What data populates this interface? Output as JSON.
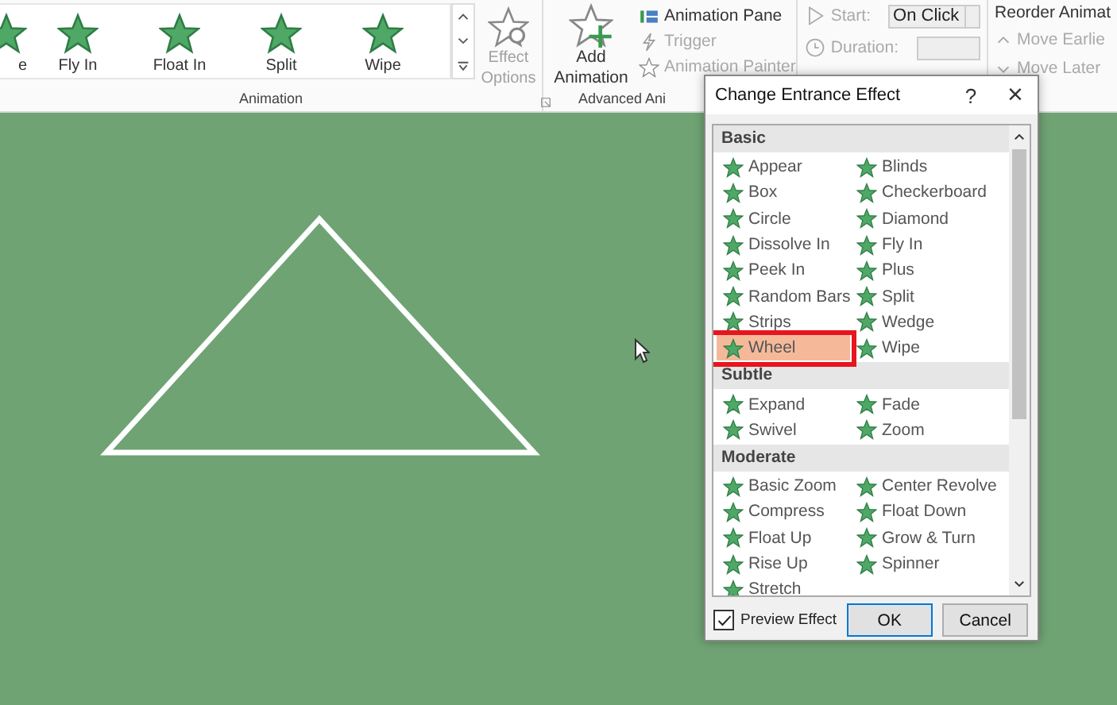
{
  "ribbon": {
    "gallery": [
      {
        "label": "e",
        "disabled": false
      },
      {
        "label": "Fly In",
        "disabled": false
      },
      {
        "label": "Float In",
        "disabled": false
      },
      {
        "label": "Split",
        "disabled": false
      },
      {
        "label": "Wipe",
        "disabled": false
      }
    ],
    "effect_options": {
      "label": "Effect Options",
      "disabled": true
    },
    "animation_group": "Animation",
    "add_animation": "Add Animation",
    "advanced": [
      {
        "label": "Animation Pane",
        "disabled": false
      },
      {
        "label": "Trigger",
        "disabled": true
      },
      {
        "label": "Animation Painter",
        "disabled": true
      }
    ],
    "advanced_group": "Advanced Ani",
    "timing": [
      {
        "label": "Start:",
        "value": "On Click",
        "kind": "dropdown"
      },
      {
        "label": "Duration:",
        "kind": "spin"
      }
    ],
    "reorder_title": "Reorder Animat",
    "reorder": [
      {
        "label": "Move Earlie",
        "disabled": true
      },
      {
        "label": "Move Later",
        "disabled": true
      }
    ]
  },
  "dialog": {
    "title": "Change Entrance Effect",
    "help": "?",
    "close": "×",
    "groups": [
      {
        "name": "Basic",
        "effects": [
          {
            "label": "Appear",
            "selected": false
          },
          {
            "label": "Blinds",
            "selected": false
          },
          {
            "label": "Box",
            "selected": false
          },
          {
            "label": "Checkerboard",
            "selected": false
          },
          {
            "label": "Circle",
            "selected": false
          },
          {
            "label": "Diamond",
            "selected": false
          },
          {
            "label": "Dissolve In",
            "selected": false
          },
          {
            "label": "Fly In",
            "selected": false
          },
          {
            "label": "Peek In",
            "selected": false
          },
          {
            "label": "Plus",
            "selected": false
          },
          {
            "label": "Random Bars",
            "selected": false
          },
          {
            "label": "Split",
            "selected": false
          },
          {
            "label": "Strips",
            "selected": false
          },
          {
            "label": "Wedge",
            "selected": false
          },
          {
            "label": "Wheel",
            "selected": true
          },
          {
            "label": "Wipe",
            "selected": false
          }
        ]
      },
      {
        "name": "Subtle",
        "effects": [
          {
            "label": "Expand",
            "selected": false
          },
          {
            "label": "Fade",
            "selected": false
          },
          {
            "label": "Swivel",
            "selected": false
          },
          {
            "label": "Zoom",
            "selected": false
          }
        ]
      },
      {
        "name": "Moderate",
        "effects": [
          {
            "label": "Basic Zoom",
            "selected": false
          },
          {
            "label": "Center Revolve",
            "selected": false
          },
          {
            "label": "Compress",
            "selected": false
          },
          {
            "label": "Float Down",
            "selected": false
          },
          {
            "label": "Float Up",
            "selected": false
          },
          {
            "label": "Grow & Turn",
            "selected": false
          },
          {
            "label": "Rise Up",
            "selected": false
          },
          {
            "label": "Spinner",
            "selected": false
          },
          {
            "label": "Stretch",
            "selected": false
          }
        ]
      }
    ],
    "preview": {
      "label": "Preview Effect",
      "checked": true
    },
    "buttons": [
      {
        "label": "OK",
        "default": true
      },
      {
        "label": "Cancel",
        "default": false
      }
    ]
  }
}
